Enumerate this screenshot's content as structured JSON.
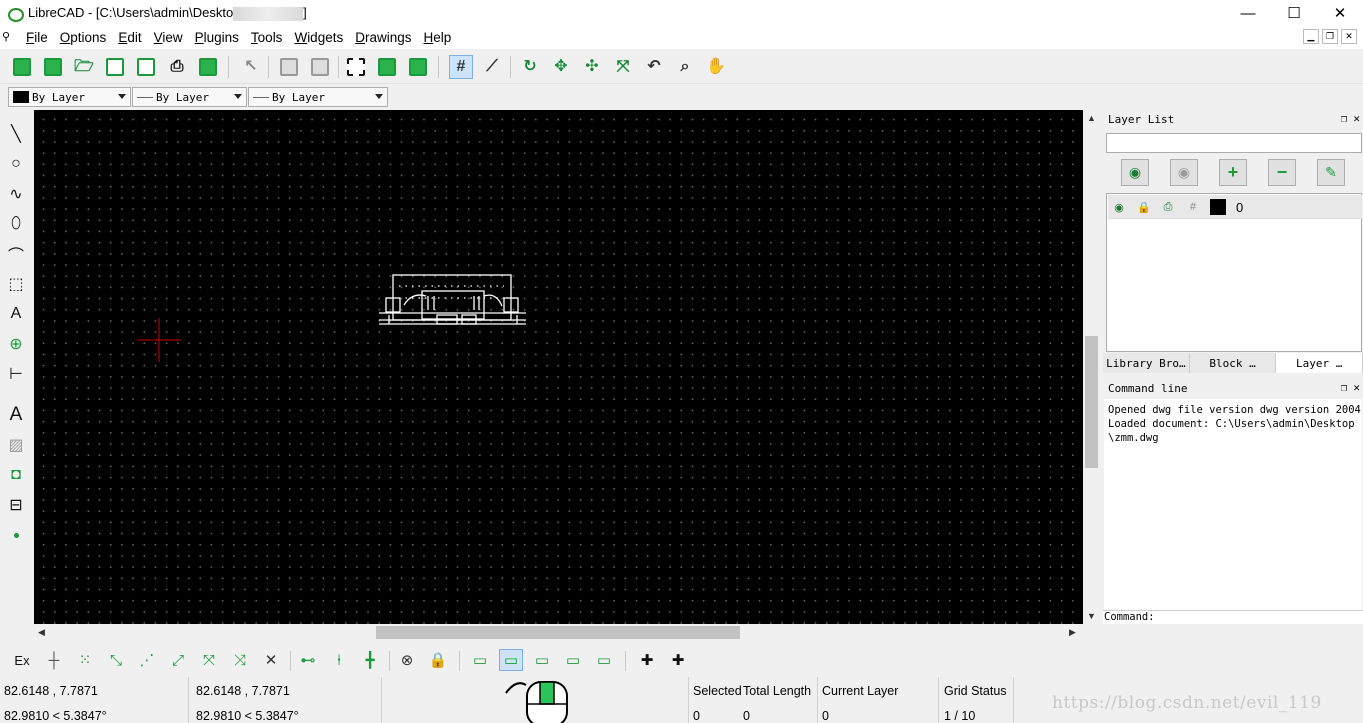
{
  "window": {
    "title_prefix": "LibreCAD - [C:\\Users\\admin\\Deskto",
    "title_suffix": "]",
    "minimize": "—",
    "maximize": "☐",
    "close": "✕"
  },
  "menu": {
    "items": [
      {
        "label": "File",
        "key": "F",
        "rest": "ile"
      },
      {
        "label": "Options",
        "key": "O",
        "rest": "ptions"
      },
      {
        "label": "Edit",
        "key": "E",
        "rest": "dit"
      },
      {
        "label": "View",
        "key": "V",
        "rest": "iew"
      },
      {
        "label": "Plugins",
        "key": "P",
        "rest": "lugins"
      },
      {
        "label": "Tools",
        "key": "T",
        "rest": "ools"
      },
      {
        "label": "Widgets",
        "key": "W",
        "rest": "idgets"
      },
      {
        "label": "Drawings",
        "key": "D",
        "rest": "rawings"
      },
      {
        "label": "Help",
        "key": "H",
        "rest": "elp"
      }
    ]
  },
  "pen_toolbar": {
    "color": "By Layer",
    "width": "By Layer",
    "linetype": "By Layer"
  },
  "layer_list": {
    "title": "Layer List",
    "layers": [
      {
        "name": "0",
        "color": "#000000"
      }
    ]
  },
  "tabs": [
    "Library Bro…",
    "Block …",
    "Layer …"
  ],
  "command_line": {
    "title": "Command line",
    "output": "Opened dwg file version dwg version 2004.\nLoaded document: C:\\Users\\admin\\Desktop\n\\zmm.dwg",
    "prompt": "Command:"
  },
  "snap": {
    "label": "Ex"
  },
  "status": {
    "abs_coord": "82.6148 , 7.7871",
    "abs_polar": "82.9810 < 5.3847°",
    "rel_coord": "82.6148 , 7.7871",
    "rel_polar": "82.9810 < 5.3847°",
    "selected_label": "Selected",
    "selected_value": "0",
    "total_length_label": "Total Length",
    "total_length_value": "0",
    "current_layer_label": "Current Layer",
    "current_layer_value": "0",
    "grid_status_label": "Grid Status",
    "grid_status_value": "1 / 10"
  },
  "watermark": "https://blog.csdn.net/evil_119",
  "colors": {
    "accent_green": "#1a9a3a",
    "canvas_bg": "#000000",
    "crosshair": "#cc0000",
    "drawing": "#ffffff"
  }
}
